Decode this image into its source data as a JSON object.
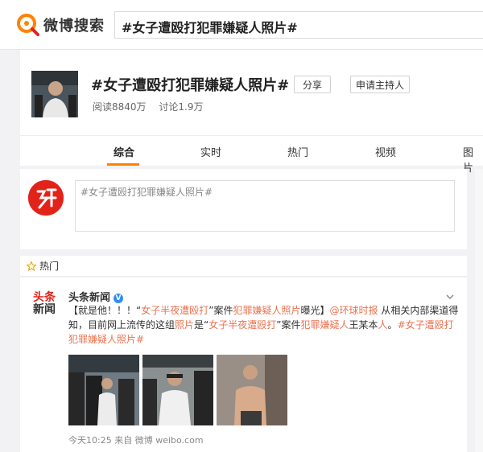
{
  "search": {
    "logo_text": "微博搜索",
    "query": "#女子遭殴打犯罪嫌疑人照片#"
  },
  "topic": {
    "title": "#女子遭殴打犯罪嫌疑人照片#",
    "reads": "阅读8840万",
    "discussions": "讨论1.9万",
    "share_label": "分享",
    "host_label": "申请主持人"
  },
  "tabs": [
    {
      "label": "综合",
      "active": true
    },
    {
      "label": "实时",
      "active": false
    },
    {
      "label": "热门",
      "active": false
    },
    {
      "label": "视频",
      "active": false
    },
    {
      "label": "图片",
      "active": false
    }
  ],
  "compose": {
    "placeholder": "#女子遭殴打犯罪嫌疑人照片#"
  },
  "hot": {
    "label": "热门"
  },
  "post": {
    "logo_line1": "头条",
    "logo_line2": "新闻",
    "author": "头条新闻",
    "text_segments": [
      {
        "t": "【就是他！！！“",
        "c": ""
      },
      {
        "t": "女子半夜",
        "c": "hl"
      },
      {
        "t": "遭殴打",
        "c": "hl"
      },
      {
        "t": "”案件",
        "c": ""
      },
      {
        "t": "犯罪嫌疑人照片",
        "c": "hl"
      },
      {
        "t": "曝光】",
        "c": ""
      },
      {
        "t": "@环球时报",
        "c": "link"
      },
      {
        "t": " 从相关内部渠道得知，目前网上流传的这组",
        "c": ""
      },
      {
        "t": "照片",
        "c": "hl"
      },
      {
        "t": "是“",
        "c": ""
      },
      {
        "t": "女子半夜",
        "c": "hl"
      },
      {
        "t": "遭殴打",
        "c": "hl"
      },
      {
        "t": "”案件",
        "c": ""
      },
      {
        "t": "犯罪嫌疑人",
        "c": "hl"
      },
      {
        "t": "王某本",
        "c": ""
      },
      {
        "t": "人",
        "c": "hl"
      },
      {
        "t": "。",
        "c": ""
      },
      {
        "t": "#女子遭殴打犯罪嫌疑人照片#",
        "c": "link"
      }
    ],
    "time": "今天10:25",
    "source_prefix": "来自",
    "source": "微博 weibo.com"
  }
}
